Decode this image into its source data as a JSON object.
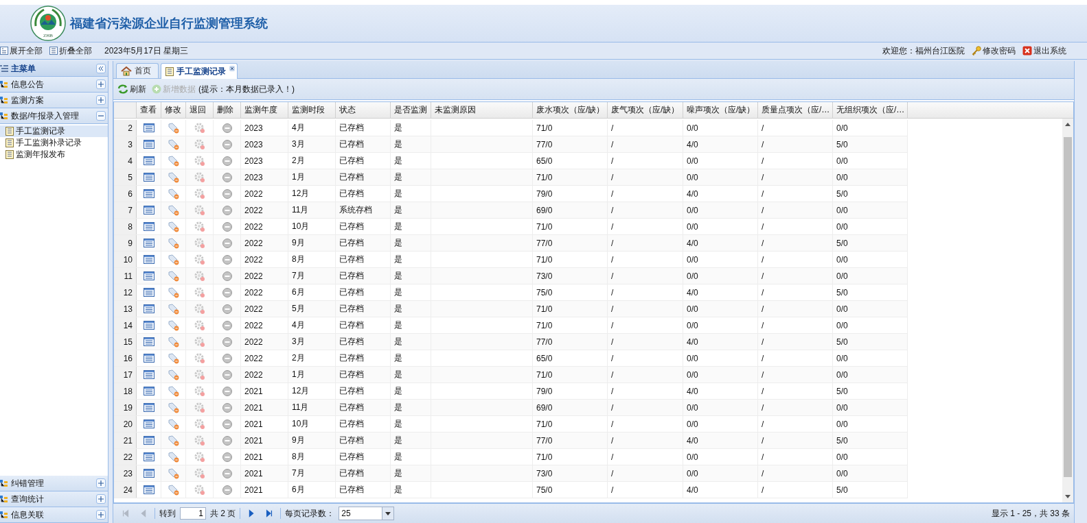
{
  "header": {
    "logo_text": "ZHB",
    "title": "福建省污染源企业自行监测管理系统"
  },
  "topbar": {
    "expand_all": "展开全部",
    "collapse_all": "折叠全部",
    "date": "2023年5月17日 星期三",
    "welcome": "欢迎您：福州台江医院",
    "change_password": "修改密码",
    "logout": "退出系统"
  },
  "sidebar": {
    "title": "主菜单",
    "groups": [
      {
        "label": "信息公告",
        "expanded": false
      },
      {
        "label": "监测方案",
        "expanded": false
      },
      {
        "label": "数据/年报录入管理",
        "expanded": true,
        "children": [
          {
            "label": "手工监测记录",
            "selected": true
          },
          {
            "label": "手工监测补录记录",
            "selected": false
          },
          {
            "label": "监测年报发布",
            "selected": false
          }
        ]
      }
    ],
    "bottom_groups": [
      {
        "label": "纠错管理",
        "expanded": false
      },
      {
        "label": "查询统计",
        "expanded": false
      },
      {
        "label": "信息关联",
        "expanded": false
      }
    ]
  },
  "tabs": [
    {
      "label": "首页",
      "selected": false,
      "kind": "home"
    },
    {
      "label": "手工监测记录",
      "selected": true,
      "kind": "page"
    }
  ],
  "toolbar": {
    "buttons": [
      {
        "label": "刷新",
        "disabled": false,
        "kind": "refresh"
      },
      {
        "label": "新增数据",
        "disabled": true,
        "kind": "add"
      }
    ],
    "hint": "(提示：本月数据已录入！)"
  },
  "table": {
    "columns": [
      "查看",
      "修改",
      "退回",
      "删除",
      "监测年度",
      "监测时段",
      "状态",
      "是否监测",
      "未监测原因",
      "废水项次（应/缺）",
      "废气项次（应/缺）",
      "噪声项次（应/缺）",
      "质量点项次（应/…",
      "无组织项次（应/…"
    ],
    "rows": [
      {
        "num": "2",
        "year": "2023",
        "period": "4月",
        "status": "已存档",
        "monitored": "是",
        "water": "71/0",
        "gas": "/",
        "noise": "0/0",
        "quality": "/",
        "unorganized": "0/0"
      },
      {
        "num": "3",
        "year": "2023",
        "period": "3月",
        "status": "已存档",
        "monitored": "是",
        "water": "77/0",
        "gas": "/",
        "noise": "4/0",
        "quality": "/",
        "unorganized": "5/0"
      },
      {
        "num": "4",
        "year": "2023",
        "period": "2月",
        "status": "已存档",
        "monitored": "是",
        "water": "65/0",
        "gas": "/",
        "noise": "0/0",
        "quality": "/",
        "unorganized": "0/0"
      },
      {
        "num": "5",
        "year": "2023",
        "period": "1月",
        "status": "已存档",
        "monitored": "是",
        "water": "71/0",
        "gas": "/",
        "noise": "0/0",
        "quality": "/",
        "unorganized": "0/0"
      },
      {
        "num": "6",
        "year": "2022",
        "period": "12月",
        "status": "已存档",
        "monitored": "是",
        "water": "79/0",
        "gas": "/",
        "noise": "4/0",
        "quality": "/",
        "unorganized": "5/0"
      },
      {
        "num": "7",
        "year": "2022",
        "period": "11月",
        "status": "系统存档",
        "monitored": "是",
        "water": "69/0",
        "gas": "/",
        "noise": "0/0",
        "quality": "/",
        "unorganized": "0/0"
      },
      {
        "num": "8",
        "year": "2022",
        "period": "10月",
        "status": "已存档",
        "monitored": "是",
        "water": "71/0",
        "gas": "/",
        "noise": "0/0",
        "quality": "/",
        "unorganized": "0/0"
      },
      {
        "num": "9",
        "year": "2022",
        "period": "9月",
        "status": "已存档",
        "monitored": "是",
        "water": "77/0",
        "gas": "/",
        "noise": "4/0",
        "quality": "/",
        "unorganized": "5/0"
      },
      {
        "num": "10",
        "year": "2022",
        "period": "8月",
        "status": "已存档",
        "monitored": "是",
        "water": "71/0",
        "gas": "/",
        "noise": "0/0",
        "quality": "/",
        "unorganized": "0/0"
      },
      {
        "num": "11",
        "year": "2022",
        "period": "7月",
        "status": "已存档",
        "monitored": "是",
        "water": "73/0",
        "gas": "/",
        "noise": "0/0",
        "quality": "/",
        "unorganized": "0/0"
      },
      {
        "num": "12",
        "year": "2022",
        "period": "6月",
        "status": "已存档",
        "monitored": "是",
        "water": "75/0",
        "gas": "/",
        "noise": "4/0",
        "quality": "/",
        "unorganized": "5/0"
      },
      {
        "num": "13",
        "year": "2022",
        "period": "5月",
        "status": "已存档",
        "monitored": "是",
        "water": "71/0",
        "gas": "/",
        "noise": "0/0",
        "quality": "/",
        "unorganized": "0/0"
      },
      {
        "num": "14",
        "year": "2022",
        "period": "4月",
        "status": "已存档",
        "monitored": "是",
        "water": "71/0",
        "gas": "/",
        "noise": "0/0",
        "quality": "/",
        "unorganized": "0/0"
      },
      {
        "num": "15",
        "year": "2022",
        "period": "3月",
        "status": "已存档",
        "monitored": "是",
        "water": "77/0",
        "gas": "/",
        "noise": "4/0",
        "quality": "/",
        "unorganized": "5/0"
      },
      {
        "num": "16",
        "year": "2022",
        "period": "2月",
        "status": "已存档",
        "monitored": "是",
        "water": "65/0",
        "gas": "/",
        "noise": "0/0",
        "quality": "/",
        "unorganized": "0/0"
      },
      {
        "num": "17",
        "year": "2022",
        "period": "1月",
        "status": "已存档",
        "monitored": "是",
        "water": "71/0",
        "gas": "/",
        "noise": "0/0",
        "quality": "/",
        "unorganized": "0/0"
      },
      {
        "num": "18",
        "year": "2021",
        "period": "12月",
        "status": "已存档",
        "monitored": "是",
        "water": "79/0",
        "gas": "/",
        "noise": "4/0",
        "quality": "/",
        "unorganized": "5/0"
      },
      {
        "num": "19",
        "year": "2021",
        "period": "11月",
        "status": "已存档",
        "monitored": "是",
        "water": "69/0",
        "gas": "/",
        "noise": "0/0",
        "quality": "/",
        "unorganized": "0/0"
      },
      {
        "num": "20",
        "year": "2021",
        "period": "10月",
        "status": "已存档",
        "monitored": "是",
        "water": "71/0",
        "gas": "/",
        "noise": "0/0",
        "quality": "/",
        "unorganized": "0/0"
      },
      {
        "num": "21",
        "year": "2021",
        "period": "9月",
        "status": "已存档",
        "monitored": "是",
        "water": "77/0",
        "gas": "/",
        "noise": "4/0",
        "quality": "/",
        "unorganized": "5/0"
      },
      {
        "num": "22",
        "year": "2021",
        "period": "8月",
        "status": "已存档",
        "monitored": "是",
        "water": "71/0",
        "gas": "/",
        "noise": "0/0",
        "quality": "/",
        "unorganized": "0/0"
      },
      {
        "num": "23",
        "year": "2021",
        "period": "7月",
        "status": "已存档",
        "monitored": "是",
        "water": "73/0",
        "gas": "/",
        "noise": "0/0",
        "quality": "/",
        "unorganized": "0/0"
      },
      {
        "num": "24",
        "year": "2021",
        "period": "6月",
        "status": "已存档",
        "monitored": "是",
        "water": "75/0",
        "gas": "/",
        "noise": "4/0",
        "quality": "/",
        "unorganized": "5/0"
      }
    ]
  },
  "pager": {
    "nav": [
      {
        "kind": "first",
        "disabled": true
      },
      {
        "kind": "prev",
        "disabled": true
      },
      {
        "kind": "next",
        "disabled": false
      },
      {
        "kind": "last",
        "disabled": false
      }
    ],
    "goto_label": "转到",
    "page": "1",
    "total_pages": "共 2 页",
    "per_page_label": "每页记录数：",
    "per_page": "25",
    "summary": "显示 1 - 25，共 33 条"
  }
}
